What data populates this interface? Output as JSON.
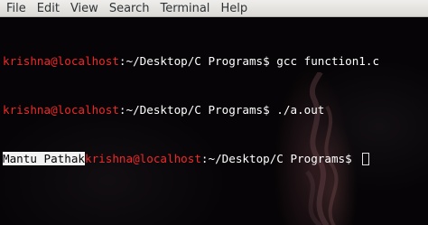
{
  "menubar": {
    "items": [
      {
        "label": "File"
      },
      {
        "label": "Edit"
      },
      {
        "label": "View"
      },
      {
        "label": "Search"
      },
      {
        "label": "Terminal"
      },
      {
        "label": "Help"
      }
    ]
  },
  "terminal": {
    "lines": [
      {
        "user_host": "krishna@localhost",
        "path_prompt": ":~/Desktop/C Programs$ ",
        "command": "gcc function1.c"
      },
      {
        "user_host": "krishna@localhost",
        "path_prompt": ":~/Desktop/C Programs$ ",
        "command": "./a.out"
      },
      {
        "program_output": "Mantu Pathak",
        "user_host": "krishna@localhost",
        "path_prompt": ":~/Desktop/C Programs$ "
      }
    ]
  },
  "colors": {
    "prompt_user": "#ef2929",
    "prompt_path": "#ffffff",
    "background": "#060406",
    "menubar": "#e6e4e0"
  }
}
